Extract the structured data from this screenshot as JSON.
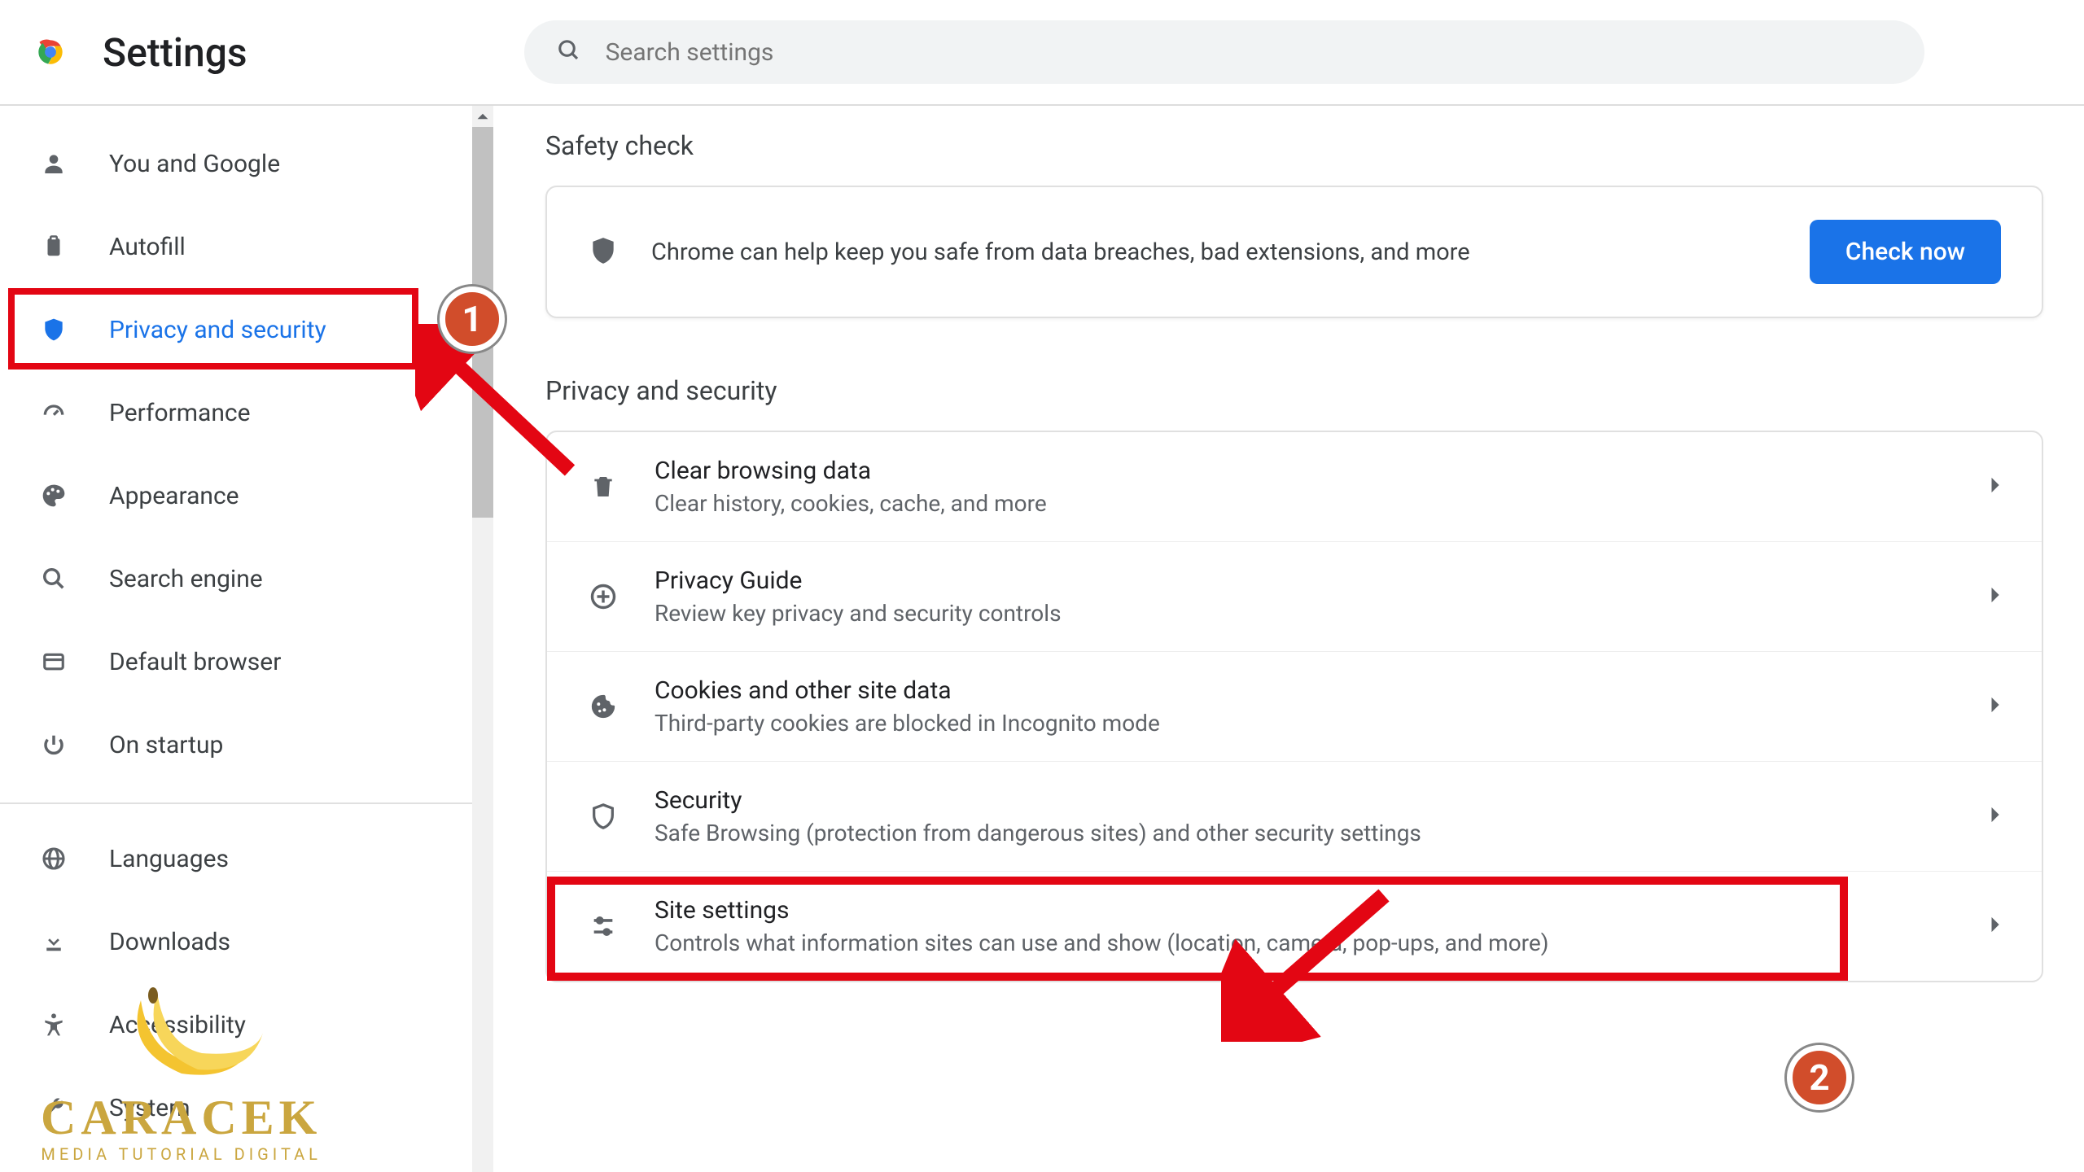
{
  "header": {
    "title": "Settings",
    "search_placeholder": "Search settings"
  },
  "sidebar": {
    "items": [
      {
        "label": "You and Google"
      },
      {
        "label": "Autofill"
      },
      {
        "label": "Privacy and security"
      },
      {
        "label": "Performance"
      },
      {
        "label": "Appearance"
      },
      {
        "label": "Search engine"
      },
      {
        "label": "Default browser"
      },
      {
        "label": "On startup"
      }
    ],
    "items2": [
      {
        "label": "Languages"
      },
      {
        "label": "Downloads"
      },
      {
        "label": "Accessibility"
      },
      {
        "label": "System"
      }
    ]
  },
  "main": {
    "safety_heading": "Safety check",
    "safety_text": "Chrome can help keep you safe from data breaches, bad extensions, and more",
    "safety_button": "Check now",
    "privacy_heading": "Privacy and security",
    "rows": [
      {
        "title": "Clear browsing data",
        "desc": "Clear history, cookies, cache, and more"
      },
      {
        "title": "Privacy Guide",
        "desc": "Review key privacy and security controls"
      },
      {
        "title": "Cookies and other site data",
        "desc": "Third-party cookies are blocked in Incognito mode"
      },
      {
        "title": "Security",
        "desc": "Safe Browsing (protection from dangerous sites) and other security settings"
      },
      {
        "title": "Site settings",
        "desc": "Controls what information sites can use and show (location, camera, pop-ups, and more)"
      }
    ]
  },
  "markers": {
    "one": "1",
    "two": "2"
  },
  "watermark": {
    "title": "CARACEK",
    "subtitle": "MEDIA TUTORIAL DIGITAL"
  }
}
